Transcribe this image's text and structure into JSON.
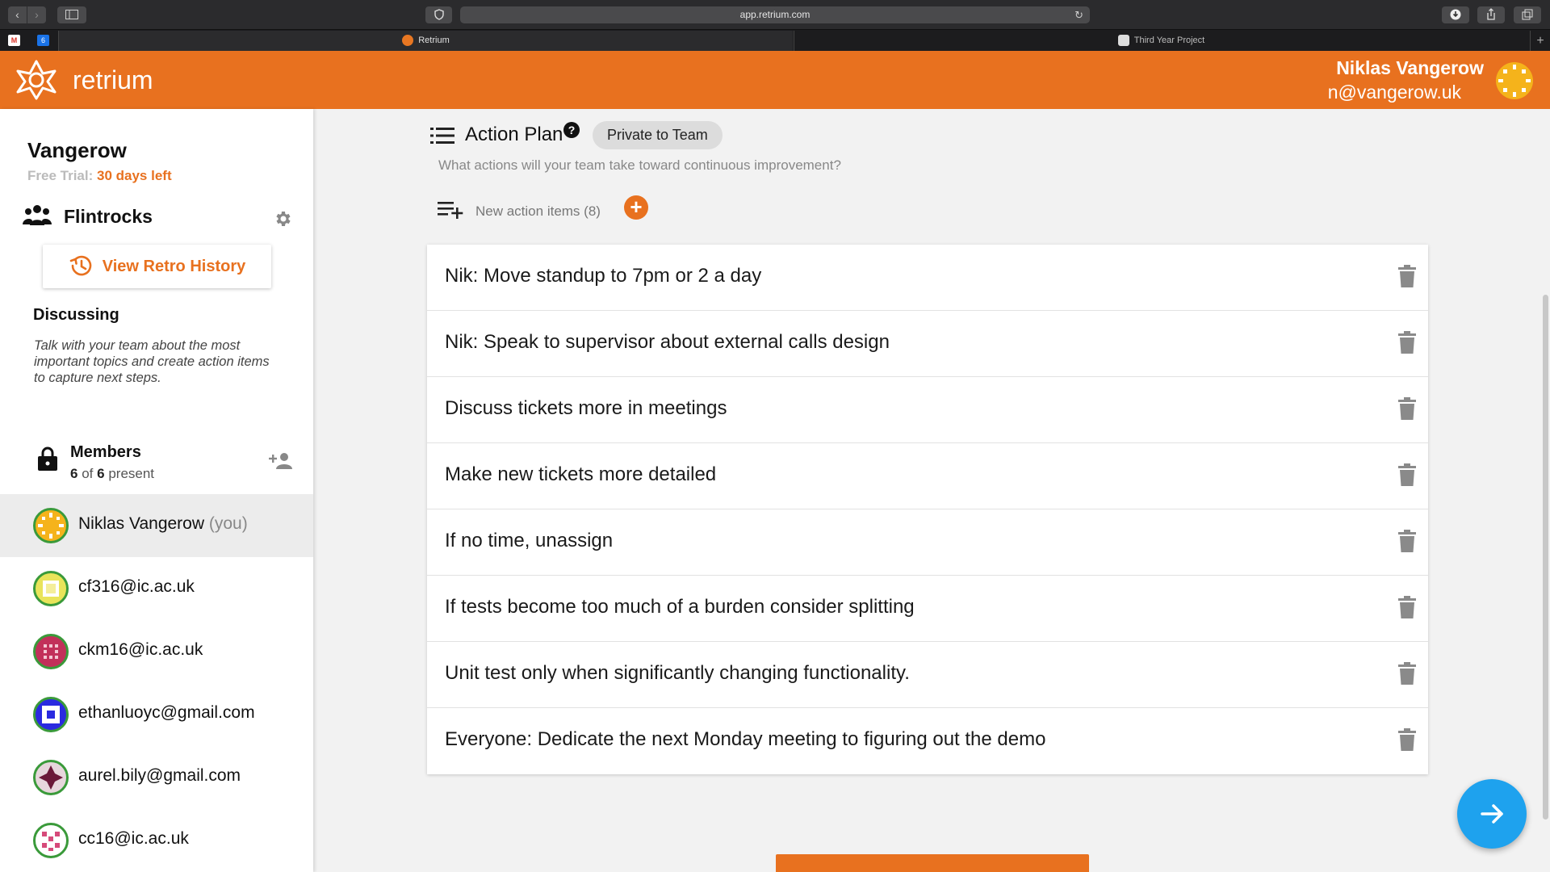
{
  "browser": {
    "url": "app.retrium.com",
    "tabs": [
      {
        "label": "Retrium"
      },
      {
        "label": "Third Year Project"
      }
    ],
    "calendar_badge": "6",
    "new_tab": "+"
  },
  "header": {
    "brand": "retrium",
    "user_name": "Niklas Vangerow",
    "user_email": "n@vangerow.uk"
  },
  "sidebar": {
    "org_name": "Vangerow",
    "trial_label": "Free Trial:",
    "trial_days": "30 days left",
    "team_name": "Flintrocks",
    "history_button": "View Retro History",
    "stage_title": "Discussing",
    "stage_description": "Talk with your team about the most important topics and create action items to capture next steps.",
    "members_title": "Members",
    "members_present": "6",
    "members_of": "of",
    "members_total": "6",
    "members_suffix": "present",
    "members": [
      {
        "name": "Niklas Vangerow",
        "suffix": "(you)",
        "avatar_color": "#f5b31b"
      },
      {
        "name": "cf316@ic.ac.uk",
        "avatar_color": "#e9e45a"
      },
      {
        "name": "ckm16@ic.ac.uk",
        "avatar_color": "#c2305a"
      },
      {
        "name": "ethanluoyc@gmail.com",
        "avatar_color": "#2a2ae0"
      },
      {
        "name": "aurel.bily@gmail.com",
        "avatar_color": "#6a1838"
      },
      {
        "name": "cc16@ic.ac.uk",
        "avatar_color": "#d64a7a"
      }
    ]
  },
  "main": {
    "title": "Action Plan",
    "help": "?",
    "privacy_chip": "Private to Team",
    "subtitle": "What actions will your team take toward continuous improvement?",
    "new_items_label": "New action items (8)",
    "add_label": "+",
    "items": [
      "Nik: Move standup to 7pm or 2 a day",
      "Nik: Speak to supervisor about external calls design",
      "Discuss tickets more in meetings",
      "Make new tickets more detailed",
      "If no time, unassign",
      "If tests become too much of a burden consider splitting",
      "Unit test only when significantly changing functionality.",
      "Everyone: Dedicate the next Monday meeting to figuring out the demo"
    ]
  },
  "colors": {
    "brand_orange": "#e8711f",
    "fab_blue": "#1ea2ee"
  },
  "icons": [
    "back-icon",
    "forward-icon",
    "sidebar-icon",
    "shield-icon",
    "reload-icon",
    "download-icon",
    "share-icon",
    "tabs-icon",
    "retrium-logo-icon",
    "team-icon",
    "gear-icon",
    "history-icon",
    "lock-icon",
    "add-member-icon",
    "list-icon",
    "help-icon",
    "playlist-add-icon",
    "plus-icon",
    "trash-icon",
    "arrow-right-icon"
  ]
}
